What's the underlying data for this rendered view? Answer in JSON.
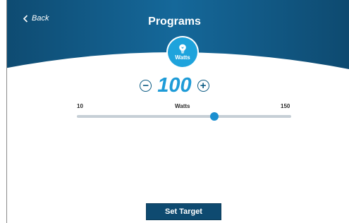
{
  "header": {
    "back_label": "Back",
    "title": "Programs"
  },
  "badge": {
    "icon": "lightbulb-icon",
    "label": "Watts"
  },
  "control": {
    "value": "100",
    "unit": "Watts",
    "min": "10",
    "max": "150",
    "slider_fraction": 0.64,
    "decrement_symbol": "−",
    "increment_symbol": "+"
  },
  "actions": {
    "set_target_label": "Set Target"
  },
  "colors": {
    "header_dark": "#0e4a70",
    "header_mid": "#14618f",
    "accent": "#1ea3dc",
    "value_text": "#1e9bd7",
    "track": "#c6cfd6"
  }
}
